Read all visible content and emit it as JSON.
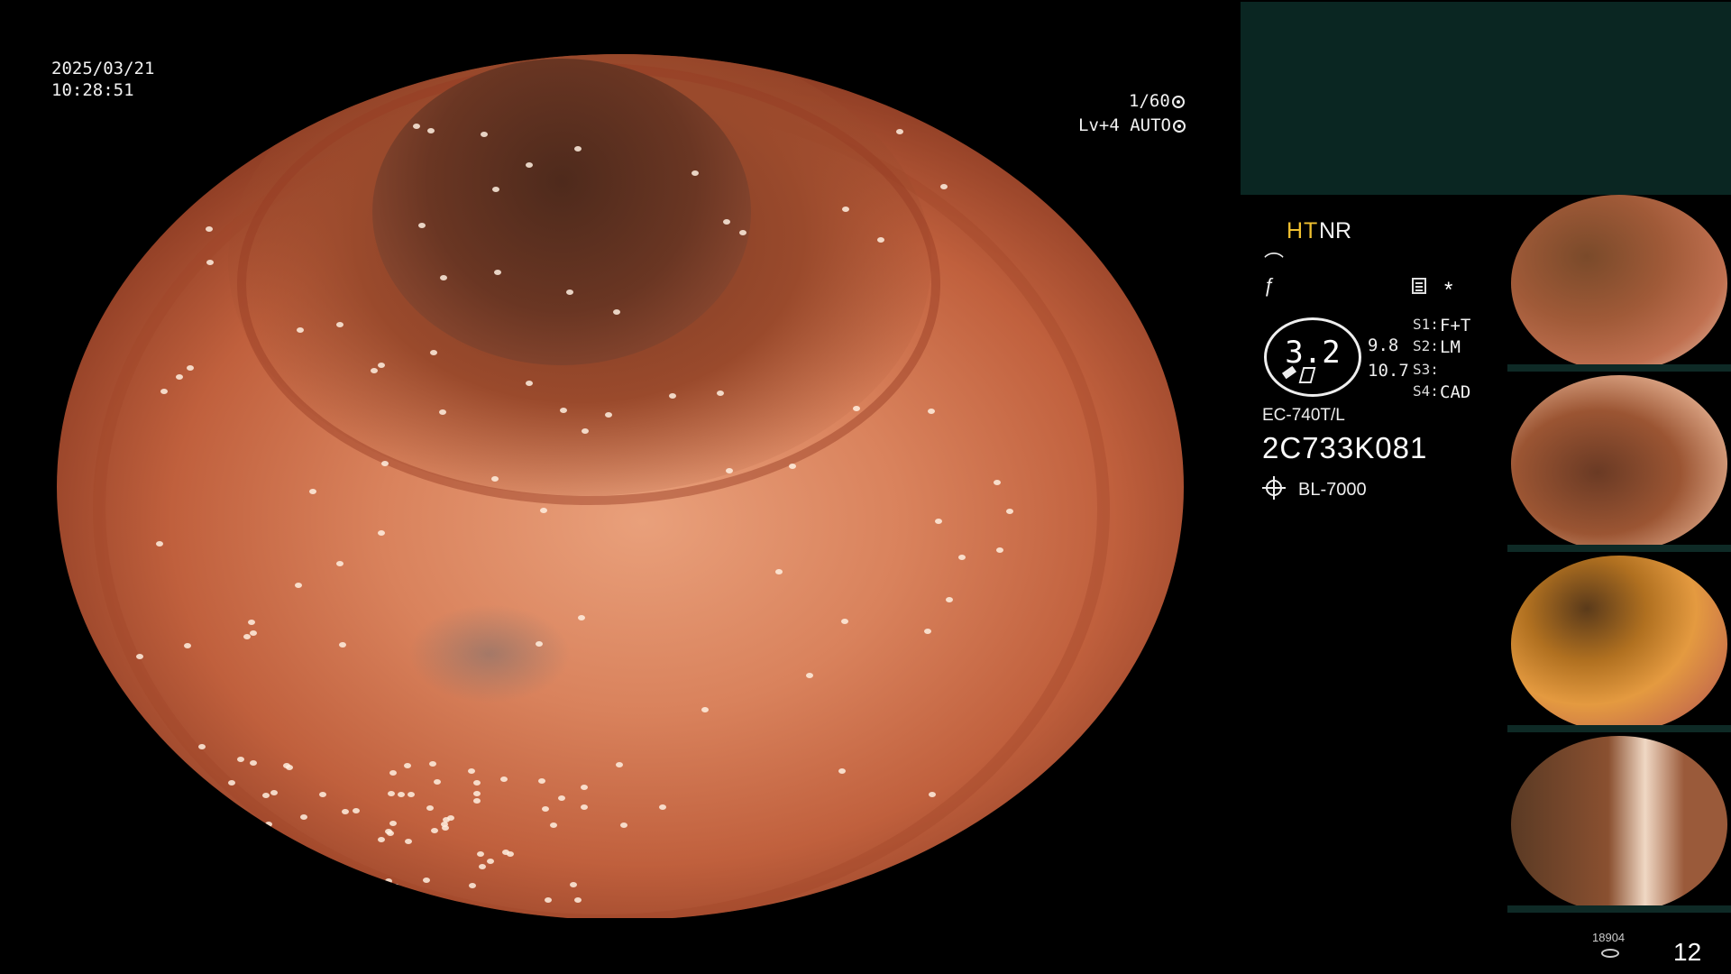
{
  "overlay": {
    "date": "2025/03/21",
    "time": "10:28:51",
    "shutter": "1/60",
    "level": "Lv+4 AUTO"
  },
  "panel": {
    "ht": "HT",
    "nr": "NR",
    "star": "*",
    "zoom": "3.2",
    "mag_top": "9.8",
    "mag_bottom": "10.7",
    "switches": [
      {
        "label": "S1:",
        "value": "F+T"
      },
      {
        "label": "S2:",
        "value": "LM"
      },
      {
        "label": "S3:",
        "value": ""
      },
      {
        "label": "S4:",
        "value": "CAD"
      }
    ],
    "scope_model": "EC-740T/L",
    "scope_serial": "2C733K081",
    "light_source": "BL-7000"
  },
  "footer": {
    "image_count_small": "18904",
    "image_count": "12"
  }
}
